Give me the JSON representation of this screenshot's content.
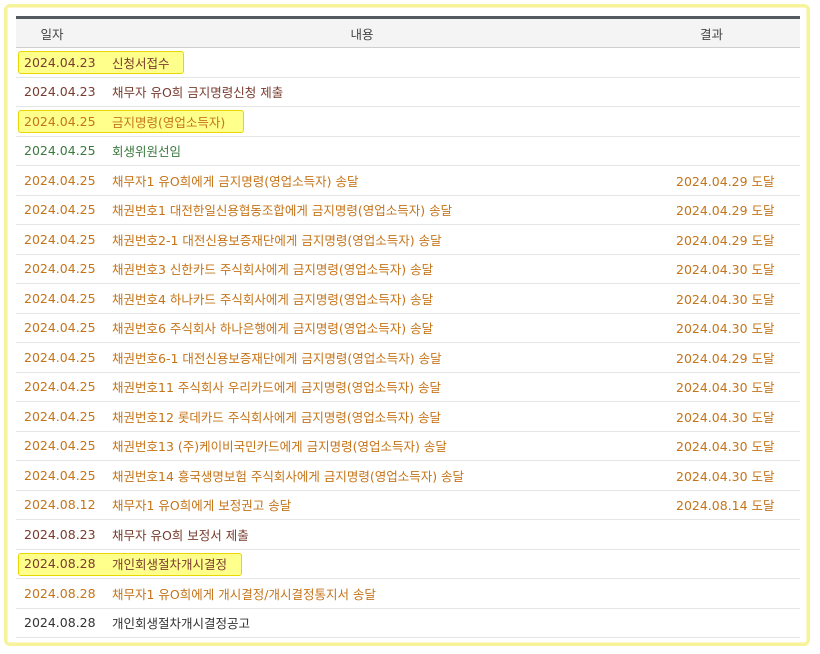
{
  "header": {
    "date": "일자",
    "content": "내용",
    "result": "결과"
  },
  "rows": [
    {
      "date": "2024.04.23",
      "content": "신청서접수",
      "result": ""
    },
    {
      "date": "2024.04.23",
      "content": "채무자 유O희 금지명령신청 제출",
      "result": ""
    },
    {
      "date": "2024.04.25",
      "content": "금지명령(영업소득자)",
      "result": ""
    },
    {
      "date": "2024.04.25",
      "content": "회생위원선임",
      "result": ""
    },
    {
      "date": "2024.04.25",
      "content": "채무자1 유O희에게 금지명령(영업소득자) 송달",
      "result": "2024.04.29 도달"
    },
    {
      "date": "2024.04.25",
      "content": "채권번호1 대전한일신용협동조합에게 금지명령(영업소득자) 송달",
      "result": "2024.04.29 도달"
    },
    {
      "date": "2024.04.25",
      "content": "채권번호2-1 대전신용보증재단에게 금지명령(영업소득자) 송달",
      "result": "2024.04.29 도달"
    },
    {
      "date": "2024.04.25",
      "content": "채권번호3 신한카드 주식회사에게 금지명령(영업소득자) 송달",
      "result": "2024.04.30 도달"
    },
    {
      "date": "2024.04.25",
      "content": "채권번호4 하나카드 주식회사에게 금지명령(영업소득자) 송달",
      "result": "2024.04.30 도달"
    },
    {
      "date": "2024.04.25",
      "content": "채권번호6 주식회사 하나은행에게 금지명령(영업소득자) 송달",
      "result": "2024.04.30 도달"
    },
    {
      "date": "2024.04.25",
      "content": "채권번호6-1 대전신용보증재단에게 금지명령(영업소득자) 송달",
      "result": "2024.04.29 도달"
    },
    {
      "date": "2024.04.25",
      "content": "채권번호11 주식회사 우리카드에게 금지명령(영업소득자) 송달",
      "result": "2024.04.30 도달"
    },
    {
      "date": "2024.04.25",
      "content": "채권번호12 롯데카드 주식회사에게 금지명령(영업소득자) 송달",
      "result": "2024.04.30 도달"
    },
    {
      "date": "2024.04.25",
      "content": "채권번호13 (주)케이비국민카드에게 금지명령(영업소득자) 송달",
      "result": "2024.04.30 도달"
    },
    {
      "date": "2024.04.25",
      "content": "채권번호14 흥국생명보험 주식회사에게 금지명령(영업소득자) 송달",
      "result": "2024.04.30 도달"
    },
    {
      "date": "2024.08.12",
      "content": "채무자1 유O희에게 보정권고 송달",
      "result": "2024.08.14 도달"
    },
    {
      "date": "2024.08.23",
      "content": "채무자 유O희 보정서 제출",
      "result": ""
    },
    {
      "date": "2024.08.28",
      "content": "개인회생절차개시결정",
      "result": ""
    },
    {
      "date": "2024.08.28",
      "content": "채무자1 유O희에게 개시결정/개시결정통지서 송달",
      "result": ""
    },
    {
      "date": "2024.08.28",
      "content": "개인회생절차개시결정공고",
      "result": ""
    }
  ],
  "colors": {
    "plum": "#7a3b2e",
    "orange": "#c57419",
    "green": "#3a7a3f",
    "dark": "#333333",
    "highlight": "#ffff8c"
  }
}
